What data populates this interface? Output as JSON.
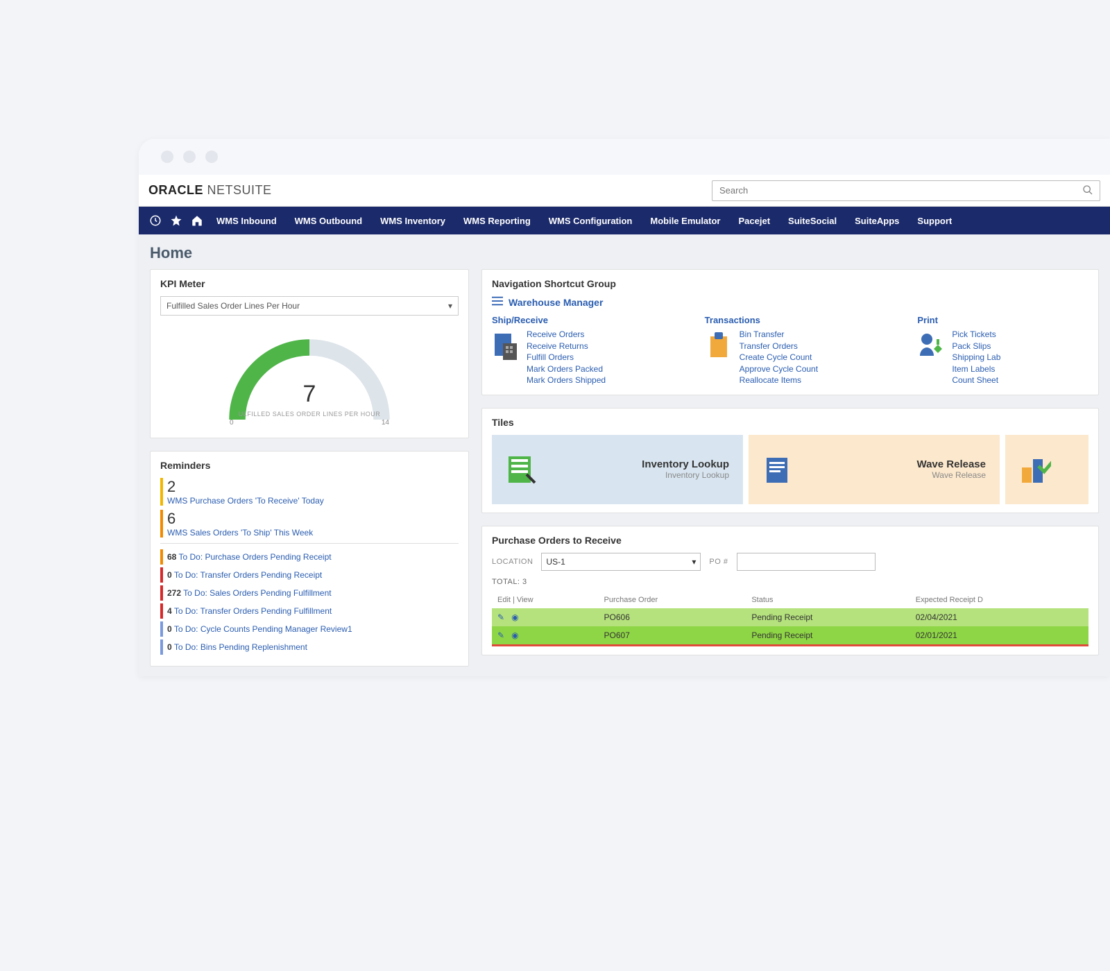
{
  "header": {
    "logo_bold": "ORACLE",
    "logo_light": " NETSUITE",
    "search_placeholder": "Search"
  },
  "nav": [
    "WMS Inbound",
    "WMS Outbound",
    "WMS Inventory",
    "WMS Reporting",
    "WMS Configuration",
    "Mobile Emulator",
    "Pacejet",
    "SuiteSocial",
    "SuiteApps",
    "Support"
  ],
  "page_title": "Home",
  "kpi": {
    "portlet_title": "KPI Meter",
    "dropdown": "Fulfilled Sales Order Lines Per Hour",
    "value": "7",
    "label": "ULFILLED SALES ORDER LINES PER HOUR",
    "scale_min": "0",
    "scale_max": "14"
  },
  "reminders": {
    "title": "Reminders",
    "big": [
      {
        "count": "2",
        "label": "WMS Purchase Orders 'To Receive' Today",
        "color": "#f2b600"
      },
      {
        "count": "6",
        "label": "WMS Sales Orders 'To Ship' This Week",
        "color": "#f28a00"
      }
    ],
    "rows": [
      {
        "count": "68",
        "label": "To Do: Purchase Orders Pending Receipt",
        "color": "#f28a00"
      },
      {
        "count": "0",
        "label": "To Do: Transfer Orders Pending Receipt",
        "color": "#d62a2a"
      },
      {
        "count": "272",
        "label": "To Do: Sales Orders Pending Fulfillment",
        "color": "#d62a2a"
      },
      {
        "count": "4",
        "label": "To Do: Transfer Orders Pending Fulfillment",
        "color": "#d62a2a"
      },
      {
        "count": "0",
        "label": "To Do: Cycle Counts Pending Manager Review1",
        "color": "#7a9adb"
      },
      {
        "count": "0",
        "label": "To Do: Bins Pending Replenishment",
        "color": "#7a9adb"
      }
    ]
  },
  "shortcuts": {
    "title": "Navigation Shortcut Group",
    "role": "Warehouse Manager",
    "groups": [
      {
        "title": "Ship/Receive",
        "links": [
          "Receive Orders",
          "Receive Returns",
          "Fulfill Orders",
          "Mark Orders Packed",
          "Mark Orders Shipped"
        ]
      },
      {
        "title": "Transactions",
        "links": [
          "Bin Transfer",
          "Transfer Orders",
          "Create Cycle Count",
          "Approve Cycle Count",
          "Reallocate Items"
        ]
      },
      {
        "title": "Print",
        "links": [
          "Pick Tickets",
          "Pack Slips",
          "Shipping Lab",
          "Item Labels",
          "Count Sheet"
        ]
      }
    ]
  },
  "tiles": {
    "title": "Tiles",
    "items": [
      {
        "title": "Inventory Lookup",
        "sub": "Inventory Lookup"
      },
      {
        "title": "Wave Release",
        "sub": "Wave Release"
      }
    ]
  },
  "po": {
    "title": "Purchase Orders to Receive",
    "location_label": "LOCATION",
    "location_value": "US-1",
    "po_label": "PO #",
    "total": "TOTAL: 3",
    "headers": {
      "edit": "Edit | View",
      "po": "Purchase Order",
      "status": "Status",
      "date": "Expected Receipt D"
    },
    "rows": [
      {
        "po": "PO606",
        "status": "Pending Receipt",
        "date": "02/04/2021"
      },
      {
        "po": "PO607",
        "status": "Pending Receipt",
        "date": "02/01/2021"
      }
    ]
  },
  "chart_data": {
    "type": "gauge",
    "title": "Fulfilled Sales Order Lines Per Hour",
    "value": 7,
    "min": 0,
    "max": 14
  }
}
